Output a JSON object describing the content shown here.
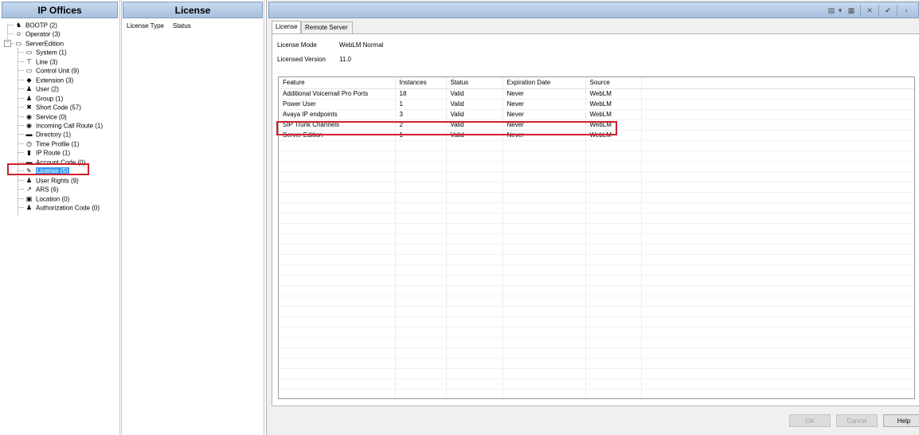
{
  "left_pane": {
    "title": "IP Offices",
    "tree": [
      {
        "label": "BOOTP (2)",
        "icon": "bootp-icon",
        "glyph": "♞"
      },
      {
        "label": "Operator (3)",
        "icon": "operator-icon",
        "glyph": "☺"
      },
      {
        "label": "ServerEdition",
        "icon": "server-icon",
        "glyph": "▭"
      },
      {
        "label": "System (1)",
        "icon": "system-icon",
        "glyph": "▭"
      },
      {
        "label": "Line (3)",
        "icon": "line-icon",
        "glyph": "⊤"
      },
      {
        "label": "Control Unit (9)",
        "icon": "control-unit-icon",
        "glyph": "▭"
      },
      {
        "label": "Extension (3)",
        "icon": "extension-icon",
        "glyph": "◆"
      },
      {
        "label": "User (2)",
        "icon": "user-icon",
        "glyph": "♟"
      },
      {
        "label": "Group (1)",
        "icon": "group-icon",
        "glyph": "♟"
      },
      {
        "label": "Short Code (57)",
        "icon": "short-code-icon",
        "glyph": "✖"
      },
      {
        "label": "Service (0)",
        "icon": "service-icon",
        "glyph": "◉"
      },
      {
        "label": "Incoming Call Route (1)",
        "icon": "incoming-call-route-icon",
        "glyph": "◉"
      },
      {
        "label": "Directory (1)",
        "icon": "directory-icon",
        "glyph": "▬"
      },
      {
        "label": "Time Profile (1)",
        "icon": "time-profile-icon",
        "glyph": "◷"
      },
      {
        "label": "IP Route (1)",
        "icon": "ip-route-icon",
        "glyph": "▮"
      },
      {
        "label": "Account Code (0)",
        "icon": "account-code-icon",
        "glyph": "▬"
      },
      {
        "label": "License (5)",
        "icon": "license-icon",
        "glyph": "✎"
      },
      {
        "label": "User Rights (9)",
        "icon": "user-rights-icon",
        "glyph": "♟"
      },
      {
        "label": "ARS (6)",
        "icon": "ars-icon",
        "glyph": "↗"
      },
      {
        "label": "Location (0)",
        "icon": "location-icon",
        "glyph": "▣"
      },
      {
        "label": "Authorization Code (0)",
        "icon": "authorization-code-icon",
        "glyph": "♟"
      }
    ],
    "expander": "−"
  },
  "middle_pane": {
    "title": "License",
    "columns": [
      "License Type",
      "Status"
    ]
  },
  "right_pane": {
    "toolbar": {
      "glyphs": [
        "▤",
        "▾",
        "▦",
        "✕",
        "✔",
        "‹"
      ],
      "icons": [
        "new-icon",
        "dropdown-icon",
        "save-icon",
        "delete-icon",
        "validate-icon",
        "previous-icon"
      ]
    },
    "tabs": [
      "License",
      "Remote Server"
    ],
    "license_mode_label": "License Mode",
    "license_mode_value": "WebLM Normal",
    "licensed_version_label": "Licensed Version",
    "licensed_version_value": "11.0",
    "table": {
      "columns": [
        "Feature",
        "Instances",
        "Status",
        "Expiration Date",
        "Source"
      ],
      "rows": [
        [
          "Additional Voicemail Pro Ports",
          "18",
          "Valid",
          "Never",
          "WebLM"
        ],
        [
          "Power User",
          "1",
          "Valid",
          "Never",
          "WebLM"
        ],
        [
          "Avaya IP endpoints",
          "3",
          "Valid",
          "Never",
          "WebLM"
        ],
        [
          "SIP Trunk Channels",
          "2",
          "Valid",
          "Never",
          "WebLM"
        ],
        [
          "Server Edition",
          "1",
          "Valid",
          "Never",
          "WebLM"
        ]
      ]
    },
    "buttons": {
      "ok": "OK",
      "cancel": "Cancel",
      "help": "Help"
    }
  },
  "colors": {
    "highlight_box": "#d0202a",
    "selection": "#3399ff",
    "header_gradient": "#a7bfdf"
  }
}
